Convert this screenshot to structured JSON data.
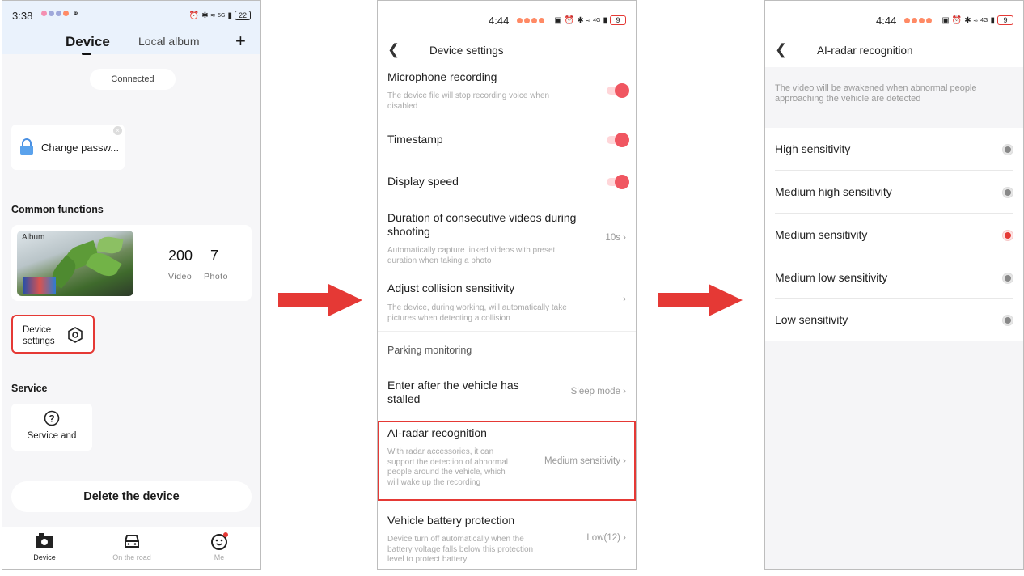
{
  "phone1": {
    "status": {
      "time": "3:38",
      "battery": "22",
      "net": "5G"
    },
    "tabs": {
      "device": "Device",
      "local_album": "Local album",
      "plus": "+"
    },
    "connection_status": "Connected",
    "password_card": {
      "label": "Change passw..."
    },
    "common_functions_title": "Common functions",
    "album": {
      "label": "Album",
      "video_count": "200",
      "video_label": "Video",
      "photo_count": "7",
      "photo_label": "Photo"
    },
    "device_settings": {
      "label_line1": "Device",
      "label_line2": "settings"
    },
    "service_title": "Service",
    "service_card": {
      "label": "Service and"
    },
    "delete_button": "Delete the device",
    "bottom_nav": [
      {
        "label": "Device",
        "icon": "camera-icon"
      },
      {
        "label": "On the road",
        "icon": "car-icon"
      },
      {
        "label": "Me",
        "icon": "smiley-icon"
      }
    ]
  },
  "phone2": {
    "status": {
      "time": "4:44",
      "battery": "9",
      "net": "4G"
    },
    "header_title": "Device settings",
    "items": {
      "mic": {
        "title": "Microphone recording",
        "desc": "The device file will stop recording voice when disabled",
        "enabled": true
      },
      "timestamp": {
        "title": "Timestamp",
        "enabled": true
      },
      "speed": {
        "title": "Display speed",
        "enabled": true
      },
      "duration": {
        "title": "Duration of consecutive videos during shooting",
        "desc": "Automatically capture linked videos with preset duration when taking a photo",
        "value": "10s"
      },
      "collision": {
        "title": "Adjust collision sensitivity",
        "desc": "The device, during working, will automatically take pictures when detecting a collision"
      },
      "parking_section": "Parking monitoring",
      "stalled": {
        "title": "Enter after the vehicle has stalled",
        "value": "Sleep mode"
      },
      "radar": {
        "title": "AI-radar recognition",
        "desc": "With radar accessories, it can support the detection of abnormal people around the vehicle, which will wake up the recording",
        "value": "Medium sensitivity"
      },
      "battery": {
        "title": "Vehicle battery protection",
        "desc": "Device turn off automatically when the battery voltage falls below this protection level to protect battery",
        "value": "Low(12)"
      }
    }
  },
  "phone3": {
    "status": {
      "time": "4:44",
      "battery": "9",
      "net": "4G"
    },
    "header_title": "AI-radar recognition",
    "info": "The video will be awakened when abnormal people approaching the vehicle are detected",
    "options": [
      {
        "label": "High sensitivity",
        "selected": false
      },
      {
        "label": "Medium high sensitivity",
        "selected": false
      },
      {
        "label": "Medium sensitivity",
        "selected": true
      },
      {
        "label": "Medium low sensitivity",
        "selected": false
      },
      {
        "label": "Low sensitivity",
        "selected": false
      }
    ]
  },
  "colors": {
    "accent_red": "#e53935",
    "toggle_on": "#f05661",
    "arrow": "#e53935",
    "header_blue": "#eaf2fc"
  }
}
